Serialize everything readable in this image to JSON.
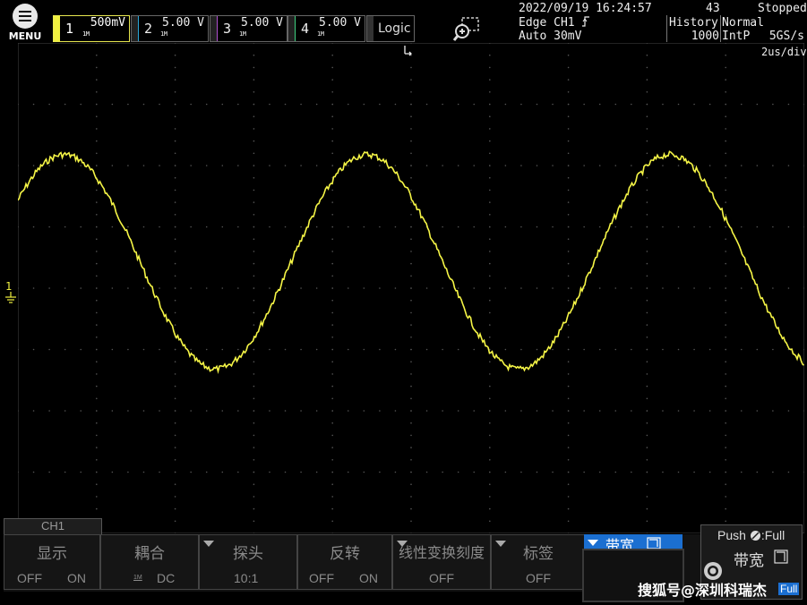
{
  "menu": {
    "label": "MENU"
  },
  "channels": [
    {
      "num": "1",
      "value": "500mV",
      "coupling": "1M",
      "color": "#f0f040"
    },
    {
      "num": "2",
      "value": "5.00 V",
      "coupling": "1M",
      "color": "#2aa6d9"
    },
    {
      "num": "3",
      "value": "5.00 V",
      "coupling": "1M",
      "color": "#b050d0"
    },
    {
      "num": "4",
      "value": "5.00 V",
      "coupling": "1M",
      "color": "#40d080"
    }
  ],
  "logic": {
    "label": "Logic"
  },
  "status": {
    "datetime": "2022/09/19 16:24:57",
    "count": "43",
    "state": "Stopped",
    "trigger_type": "Edge CH1",
    "trigger_mode": "Auto",
    "trigger_level": "30mV",
    "history_label": "History",
    "history_value": "1000",
    "acq_mode": "Normal",
    "interp": "IntP",
    "sample_rate": "5GS/s"
  },
  "timebase": "2us/div",
  "channel_tab": "CH1",
  "softkeys": [
    {
      "title": "显示",
      "off": "OFF",
      "on": "ON"
    },
    {
      "title": "耦合",
      "value": "DC",
      "coupling": "1M"
    },
    {
      "title": "探头",
      "value": "10:1"
    },
    {
      "title": "反转",
      "off": "OFF",
      "on": "ON"
    },
    {
      "title": "线性变换刻度",
      "value": "OFF"
    },
    {
      "title": "标签",
      "value": "OFF"
    },
    {
      "title": "带宽"
    }
  ],
  "push_panel": {
    "label": ":Full",
    "prefix": "Push",
    "bw": "带宽",
    "bottom": "Full"
  },
  "watermark": "搜狐号@深圳科瑞杰",
  "waveform": {
    "color": "#f5f546",
    "period_us": 7.7,
    "amplitude_div": 1.75,
    "offset_div": 0.43
  }
}
